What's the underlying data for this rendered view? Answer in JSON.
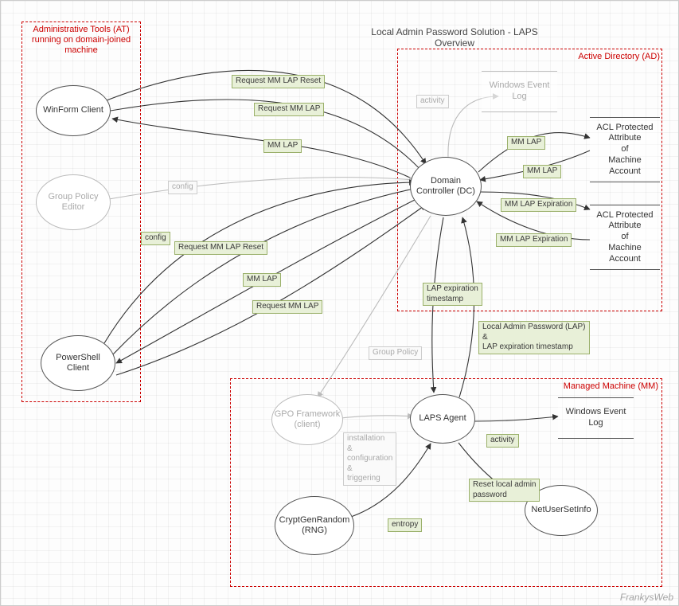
{
  "title": "Local Admin Password Solution - LAPS\nOverview",
  "watermark": "FrankysWeb",
  "groups": {
    "at": {
      "label": "Administrative Tools (AT)\nrunning on domain-joined\nmachine"
    },
    "ad": {
      "label": "Active Directory (AD)"
    },
    "mm": {
      "label": "Managed Machine (MM)"
    }
  },
  "nodes": {
    "winform": {
      "label": "WinForm Client"
    },
    "gpe": {
      "label": "Group Policy\nEditor"
    },
    "psclient": {
      "label": "PowerShell\nClient"
    },
    "dc": {
      "label": "Domain\nController (DC)"
    },
    "gpofw": {
      "label": "GPO Framework\n(client)"
    },
    "laps": {
      "label": "LAPS Agent"
    },
    "rng": {
      "label": "CryptGenRandom\n(RNG)"
    },
    "nusi": {
      "label": "NetUserSetInfo"
    }
  },
  "blocks": {
    "wel_ad": {
      "label": "Windows Event\nLog"
    },
    "acl1": {
      "label": "ACL Protected\nAttribute\nof\nMachine\nAccount"
    },
    "acl2": {
      "label": "ACL Protected\nAttribute\nof\nMachine\nAccount"
    },
    "wel_mm": {
      "label": "Windows Event\nLog"
    }
  },
  "labels": {
    "req_reset_wf": "Request MM LAP Reset",
    "req_lap_wf": "Request MM LAP",
    "mm_lap_wf": "MM LAP",
    "activity_ad": "activity",
    "mm_lap_acl1a": "MM LAP",
    "mm_lap_acl1b": "MM LAP",
    "mm_lapexp_a": "MM LAP Expiration",
    "mm_lapexp_b": "MM LAP Expiration",
    "config_gpe": "config",
    "config_ps": "config",
    "req_reset_ps": "Request MM LAP Reset",
    "mm_lap_ps": "MM LAP",
    "req_lap_ps": "Request MM LAP",
    "lap_exp_ts": "LAP expiration\ntimestamp",
    "lap_and_ts": "Local Admin Password (LAP)\n&\nLAP expiration timestamp",
    "group_policy": "Group Policy",
    "install_cfg": "installation\n&\nconfiguration\n&\ntriggering",
    "activity_mm": "activity",
    "entropy": "entropy",
    "reset_pwd": "Reset local admin\npassword"
  }
}
